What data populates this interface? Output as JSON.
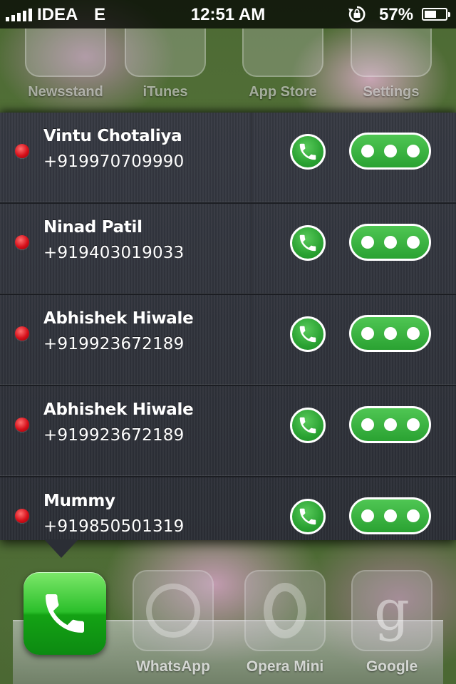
{
  "status_bar": {
    "carrier": "IDEA",
    "network": "E",
    "time": "12:51 AM",
    "battery_percent": "57%",
    "battery_level": 0.57,
    "icons": [
      "signal-icon",
      "rotation-lock-icon",
      "battery-icon"
    ]
  },
  "background_apps": [
    {
      "label": "Newsstand"
    },
    {
      "label": "iTunes"
    },
    {
      "label": "App Store"
    },
    {
      "label": "Settings"
    }
  ],
  "contacts": [
    {
      "name": "Vintu Chotaliya",
      "number": "+919970709990"
    },
    {
      "name": "Ninad Patil",
      "number": "+919403019033"
    },
    {
      "name": "Abhishek Hiwale",
      "number": "+919923672189"
    },
    {
      "name": "Abhishek Hiwale",
      "number": "+919923672189"
    },
    {
      "name": "Mummy",
      "number": "+919850501319"
    }
  ],
  "dock": {
    "apps": [
      {
        "label": "",
        "icon": "phone-icon"
      },
      {
        "label": "WhatsApp",
        "icon": "whatsapp-icon"
      },
      {
        "label": "Opera Mini",
        "icon": "opera-icon"
      },
      {
        "label": "Google",
        "icon": "google-icon"
      }
    ]
  },
  "colors": {
    "accent_green": "#2aa232",
    "status_dot_red": "#d6101a",
    "panel_bg": "#2d3038"
  }
}
